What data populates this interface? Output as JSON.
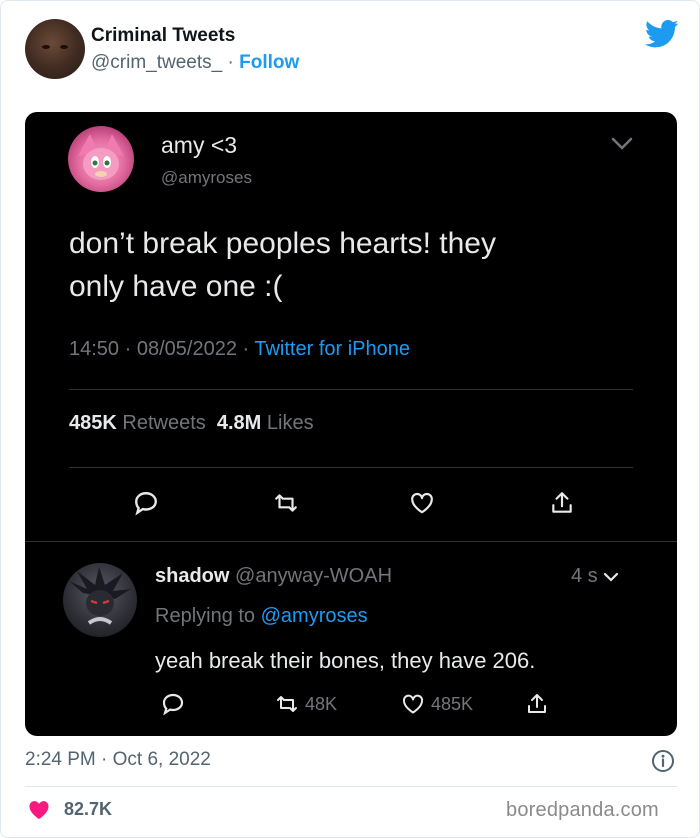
{
  "header": {
    "account_name": "Criminal Tweets",
    "handle": "@crim_tweets_",
    "separator": "·",
    "follow_label": "Follow",
    "brand_icon": "twitter-bird-icon",
    "brand_color": "#1d9bf0"
  },
  "embedded_tweet": {
    "author_name": "amy <3",
    "author_handle": "@amyroses",
    "text_line1": "don’t break peoples hearts! they",
    "text_line2": "only have one :(",
    "time": "14:50",
    "date": "08/05/2022",
    "source": "Twitter for iPhone",
    "retweets_count": "485K",
    "retweets_label": "Retweets",
    "likes_count": "4.8M",
    "likes_label": "Likes",
    "actions": [
      "reply-icon",
      "retweet-icon",
      "like-icon",
      "share-icon"
    ]
  },
  "reply": {
    "author_name": "shadow",
    "author_handle": "@anyway-WOAH",
    "time_ago": "4 s",
    "replying_prefix": "Replying to",
    "replying_to": "@amyroses",
    "text": "yeah break their bones, they have 206.",
    "retweets": "48K",
    "likes": "485K"
  },
  "footer": {
    "timestamp": "2:24 PM · Oct 6, 2022",
    "like_count": "82.7K",
    "watermark": "boredpanda.com",
    "heart_color": "#f91880"
  }
}
